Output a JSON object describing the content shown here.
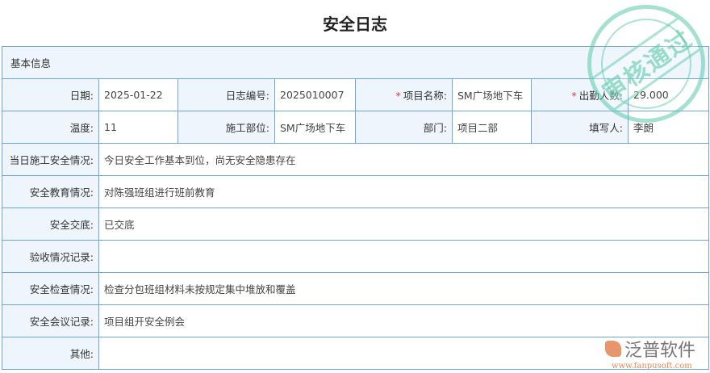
{
  "title": "安全日志",
  "section": "基本信息",
  "row1": [
    {
      "label": "日期:",
      "value": "2025-01-22"
    },
    {
      "label": "日志编号:",
      "value": "2025010007"
    },
    {
      "label": "项目名称:",
      "value": "SM广场地下车",
      "required": true
    },
    {
      "label": "出勤人数:",
      "value": "29.000",
      "required": true
    }
  ],
  "row2": [
    {
      "label": "温度:",
      "value": "11"
    },
    {
      "label": "施工部位:",
      "value": "SM广场地下车"
    },
    {
      "label": "部门:",
      "value": "项目二部"
    },
    {
      "label": "填写人:",
      "value": "李朗"
    }
  ],
  "wide": [
    {
      "label": "当日施工安全情况:",
      "value": "今日安全工作基本到位，尚无安全隐患存在"
    },
    {
      "label": "安全教育情况:",
      "value": "对陈强班组进行班前教育"
    },
    {
      "label": "安全交底:",
      "value": "已交底"
    },
    {
      "label": "验收情况记录:",
      "value": ""
    },
    {
      "label": "安全检查情况:",
      "value": "检查分包班组材料未按规定集中堆放和覆盖"
    },
    {
      "label": "安全会议记录:",
      "value": "项目组开安全例会"
    },
    {
      "label": "其他:",
      "value": ""
    }
  ],
  "required_mark": "*",
  "stamp": "审核通过",
  "logo": {
    "name": "泛普软件",
    "url": "www.fanpusoft.com"
  }
}
